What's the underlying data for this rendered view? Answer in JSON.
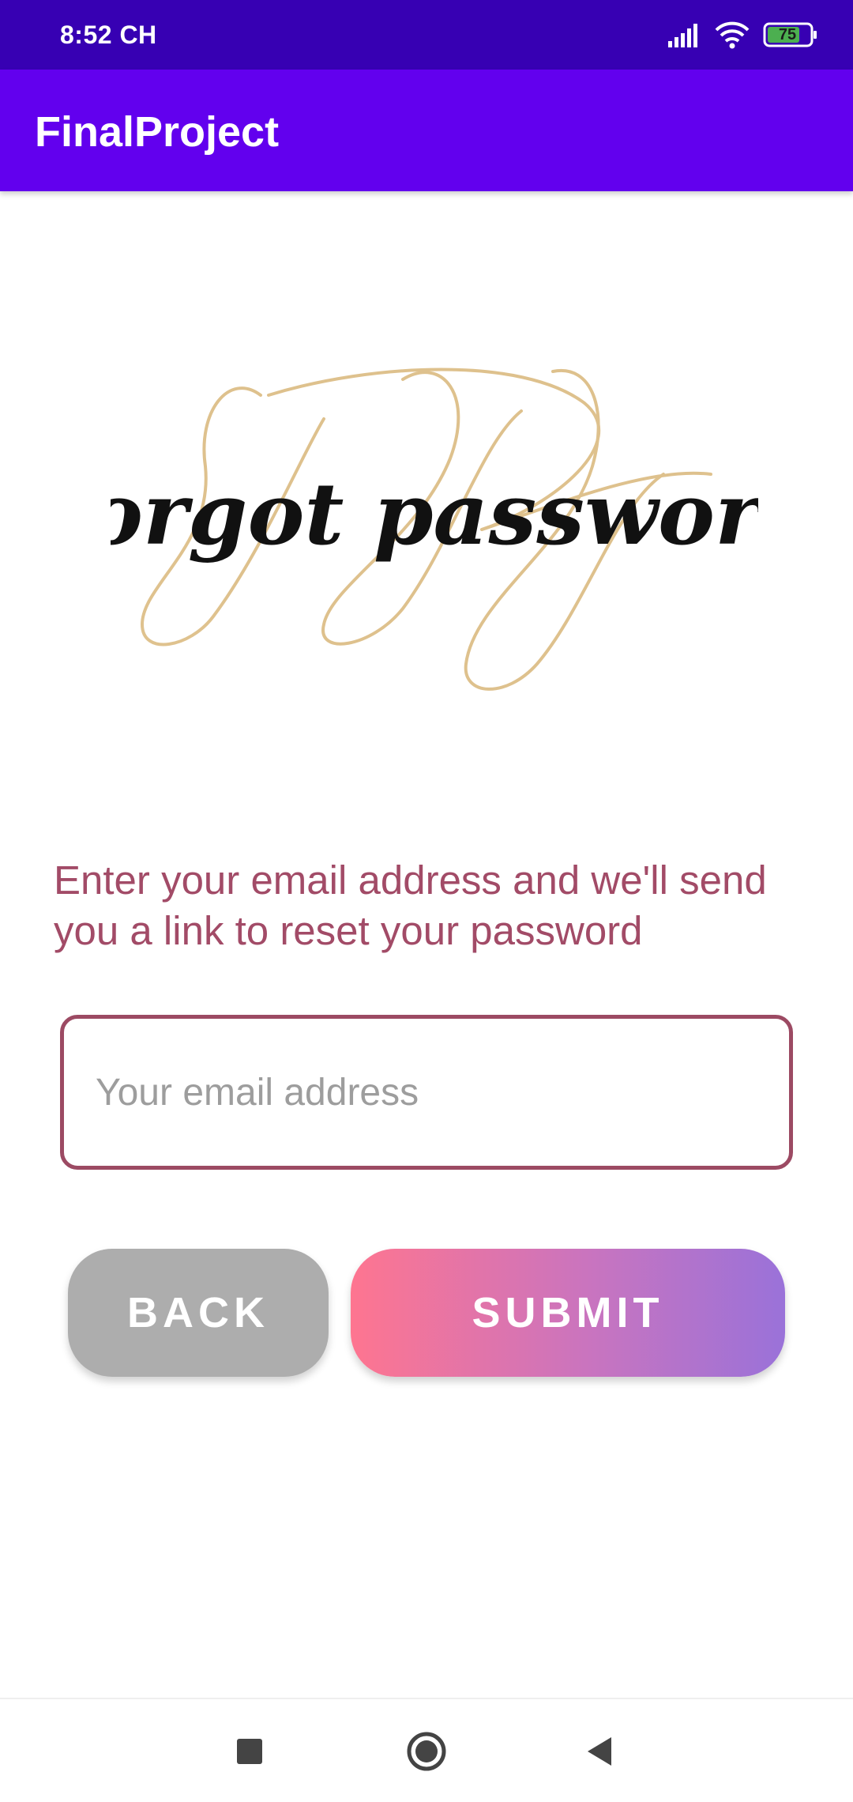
{
  "status_bar": {
    "time": "8:52 CH",
    "battery_level": "75",
    "icons": [
      "signal-icon",
      "wifi-icon",
      "battery-icon"
    ]
  },
  "app_bar": {
    "title": "FinalProject"
  },
  "hero": {
    "image_text": "forgot password"
  },
  "form": {
    "instruction": "Enter your email address and we'll send you a link to reset your password",
    "email_placeholder": "Your email address",
    "email_value": ""
  },
  "buttons": {
    "back_label": "BACK",
    "submit_label": "SUBMIT"
  },
  "navigation": {
    "items": [
      "recent-apps-icon",
      "home-icon",
      "back-icon"
    ]
  },
  "colors": {
    "status_bar": "#3700b3",
    "app_bar": "#6200ee",
    "accent_text": "#a24b67",
    "input_border": "#9c4a63",
    "back_button": "#adadad",
    "submit_gradient_start": "#fe7590",
    "submit_gradient_end": "#9a72d9"
  }
}
